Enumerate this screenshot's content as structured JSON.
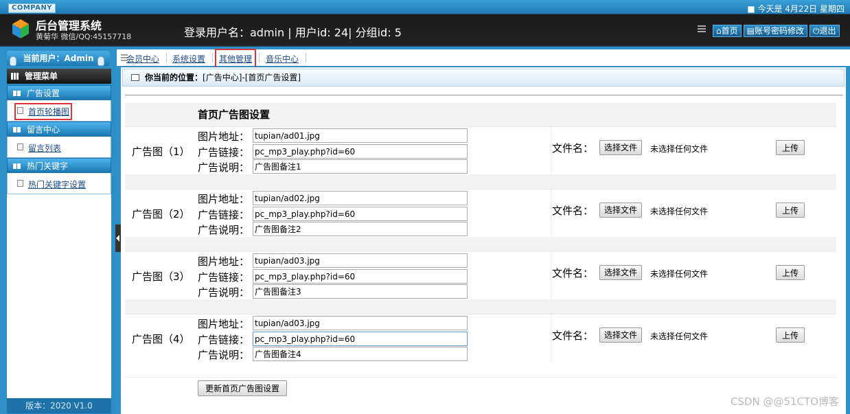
{
  "header": {
    "company": "COMPANY",
    "date": "■ 今天是 4月22日 星期四",
    "title": "后台管理系统",
    "subtitle": "黄菊华 微信/QQ:45157718",
    "login_info": "登录用户名：admin | 用户id: 24| 分组id: 5",
    "buttons": [
      {
        "label": "首页",
        "icon": "home-icon"
      },
      {
        "label": "账号密码修改",
        "icon": "account-icon"
      },
      {
        "label": "退出",
        "icon": "power-icon"
      }
    ]
  },
  "sidebar": {
    "current_user": "当前用户：Admin",
    "menu_title": "管理菜单",
    "groups": [
      {
        "title": "广告设置",
        "item": "首页轮播图"
      },
      {
        "title": "留言中心",
        "item": "留言列表"
      },
      {
        "title": "热门关键字",
        "item": "热门关键字设置"
      }
    ],
    "version": "版本：2020 V1.0"
  },
  "nav": {
    "tabs": [
      "会员中心",
      "系统设置",
      "其他管理",
      "音乐中心"
    ]
  },
  "main": {
    "breadcrumb_label": "你当前的位置：",
    "breadcrumb_path": "[广告中心]-[首页广告设置]",
    "form_title": "首页广告图设置",
    "field_labels": {
      "image": "图片地址：",
      "link": "广告链接：",
      "desc": "广告说明："
    },
    "file_label": "文件名：",
    "choose_file": "选择文件",
    "no_file": "未选择任何文件",
    "upload": "上传",
    "ads": [
      {
        "label": "广告图（1）",
        "image": "tupian/ad01.jpg",
        "link": "pc_mp3_play.php?id=60",
        "desc": "广告图备注1"
      },
      {
        "label": "广告图（2）",
        "image": "tupian/ad02.jpg",
        "link": "pc_mp3_play.php?id=60",
        "desc": "广告图备注2"
      },
      {
        "label": "广告图（3）",
        "image": "tupian/ad03.jpg",
        "link": "pc_mp3_play.php?id=60",
        "desc": "广告图备注3"
      },
      {
        "label": "广告图（4）",
        "image": "tupian/ad03.jpg",
        "link": "pc_mp3_play.php?id=60",
        "desc": "广告图备注4"
      }
    ],
    "submit": "更新首页广告图设置",
    "watermark": "CSDN @@51CTO博客"
  }
}
